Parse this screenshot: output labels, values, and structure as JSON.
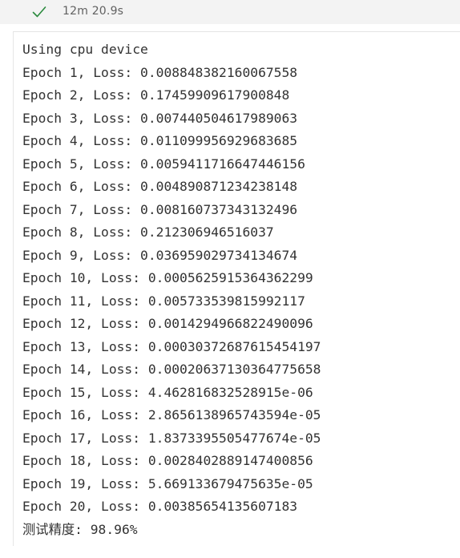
{
  "cell_status": {
    "icon": "checkmark-icon",
    "success_color": "#2b8a3e",
    "duration": "12m 20.9s"
  },
  "output": {
    "lines": [
      "Using cpu device",
      "Epoch 1, Loss: 0.008848382160067558",
      "Epoch 2, Loss: 0.17459909617900848",
      "Epoch 3, Loss: 0.007440504617989063",
      "Epoch 4, Loss: 0.011099956929683685",
      "Epoch 5, Loss: 0.005941171664744615​6",
      "Epoch 6, Loss: 0.004890871234238148",
      "Epoch 7, Loss: 0.008160737343132496",
      "Epoch 8, Loss: 0.212306946516037",
      "Epoch 9, Loss: 0.036959029734134674",
      "Epoch 10, Loss: 0.0005625915364362299",
      "Epoch 11, Loss: 0.005733539815992117",
      "Epoch 12, Loss: 0.0014294966822490096",
      "Epoch 13, Loss: 0.00030372687615454197",
      "Epoch 14, Loss: 0.00020637130364775658",
      "Epoch 15, Loss: 4.462816832528915e-06",
      "Epoch 16, Loss: 2.8656138965743594e-05",
      "Epoch 17, Loss: 1.8373395505477674e-05",
      "Epoch 18, Loss: 0.0028402889147400856",
      "Epoch 19, Loss: 5.669133679475635e-05",
      "Epoch 20, Loss: 0.00385654135607183",
      "测试精度: 98.96%"
    ]
  }
}
